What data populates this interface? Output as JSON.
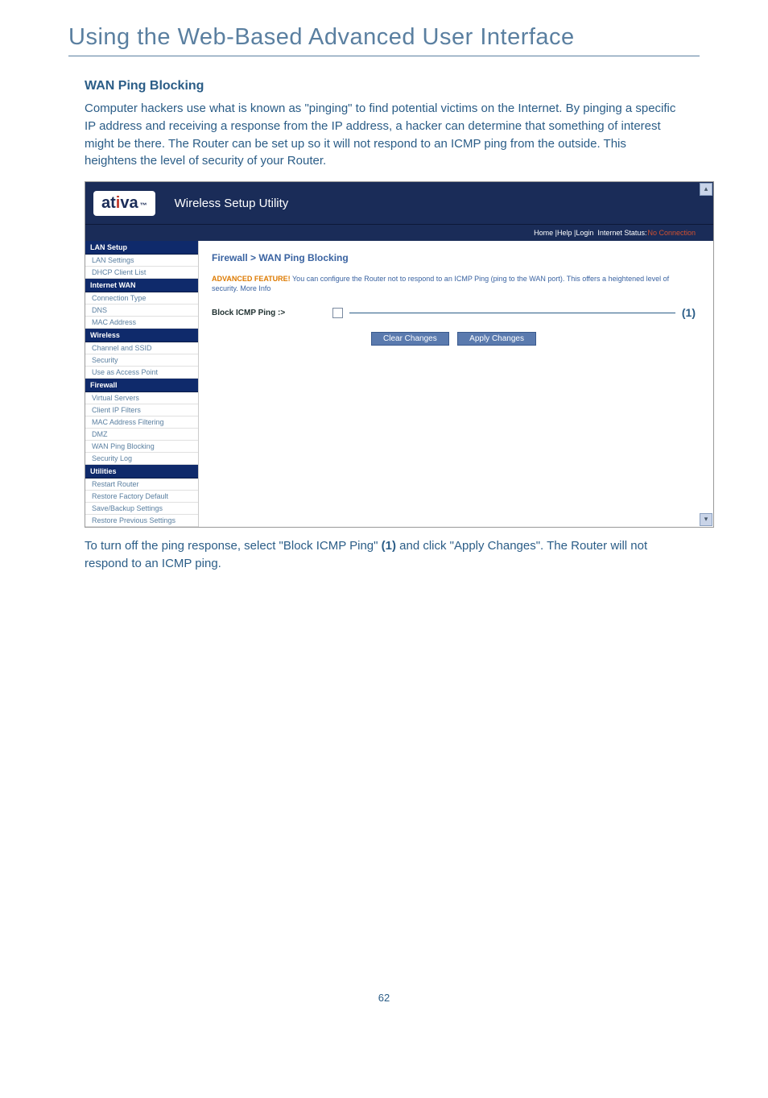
{
  "page_title": "Using the Web-Based Advanced User Interface",
  "section_heading": "WAN Ping Blocking",
  "body_paragraph": "Computer hackers use what is known as \"pinging\" to find potential victims on the Internet. By pinging a specific IP address and receiving a response from the IP address, a hacker can determine that something of interest might be there. The Router can be set up so it will not respond to an ICMP ping from the outside. This heightens the level of security of your Router.",
  "followup_pre": "To turn off the ping response, select \"Block ICMP Ping\" ",
  "followup_bold": "(1)",
  "followup_post": " and click \"Apply Changes\". The Router will not respond to an ICMP ping.",
  "page_number": "62",
  "screenshot": {
    "logo_text": "ativa",
    "header_title": "Wireless Setup Utility",
    "topbar_links": "Home |Help |Login",
    "topbar_status_label": "Internet Status:",
    "topbar_status_value": "No Connection",
    "sidebar": [
      {
        "type": "cat",
        "label": "LAN Setup"
      },
      {
        "type": "item",
        "label": "LAN Settings"
      },
      {
        "type": "item",
        "label": "DHCP Client List"
      },
      {
        "type": "cat",
        "label": "Internet WAN"
      },
      {
        "type": "item",
        "label": "Connection Type"
      },
      {
        "type": "item",
        "label": "DNS"
      },
      {
        "type": "item",
        "label": "MAC Address"
      },
      {
        "type": "cat",
        "label": "Wireless"
      },
      {
        "type": "item",
        "label": "Channel and SSID"
      },
      {
        "type": "item",
        "label": "Security"
      },
      {
        "type": "item",
        "label": "Use as Access Point"
      },
      {
        "type": "cat",
        "label": "Firewall"
      },
      {
        "type": "item",
        "label": "Virtual Servers"
      },
      {
        "type": "item",
        "label": "Client IP Filters"
      },
      {
        "type": "item",
        "label": "MAC Address Filtering"
      },
      {
        "type": "item",
        "label": "DMZ"
      },
      {
        "type": "item",
        "label": "WAN Ping Blocking"
      },
      {
        "type": "item",
        "label": "Security Log"
      },
      {
        "type": "cat",
        "label": "Utilities"
      },
      {
        "type": "item",
        "label": "Restart Router"
      },
      {
        "type": "item",
        "label": "Restore Factory Default"
      },
      {
        "type": "item",
        "label": "Save/Backup Settings"
      },
      {
        "type": "item",
        "label": "Restore Previous Settings"
      }
    ],
    "breadcrumb": "Firewall > WAN Ping Blocking",
    "adv_label": "ADVANCED FEATURE!",
    "adv_text": " You can configure the Router not to respond to an ICMP Ping (ping to the WAN port). This offers a heightened level of security. ",
    "adv_more": "More Info",
    "block_label": "Block ICMP Ping :>",
    "marker": "(1)",
    "btn_clear": "Clear Changes",
    "btn_apply": "Apply Changes"
  }
}
